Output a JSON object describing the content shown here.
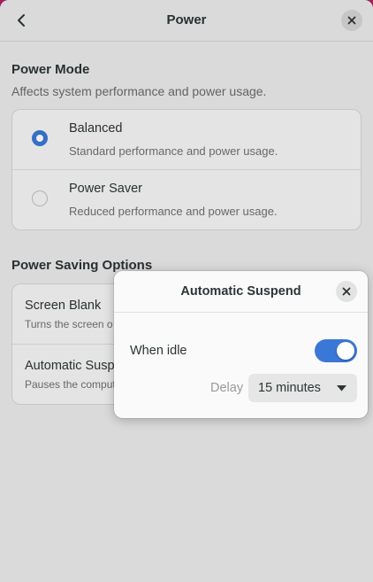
{
  "header": {
    "title": "Power"
  },
  "power_mode": {
    "title": "Power Mode",
    "subtitle": "Affects system performance and power usage.",
    "options": [
      {
        "label": "Balanced",
        "description": "Standard performance and power usage.",
        "selected": true
      },
      {
        "label": "Power Saver",
        "description": "Reduced performance and power usage.",
        "selected": false
      }
    ]
  },
  "power_saving": {
    "title": "Power Saving Options",
    "rows": [
      {
        "label": "Screen Blank",
        "description": "Turns the screen o"
      },
      {
        "label": "Automatic Susp",
        "description": "Pauses the comput"
      }
    ]
  },
  "dialog": {
    "title": "Automatic Suspend",
    "when_idle_label": "When idle",
    "when_idle_enabled": true,
    "delay_label": "Delay",
    "delay_value": "15 minutes"
  },
  "colors": {
    "accent": "#3a77d6",
    "wallpaper": "#a0205a",
    "window_bg": "#ebebeb"
  },
  "icons": {
    "back": "go-previous-icon",
    "close": "window-close-icon",
    "dropdown": "pan-down-icon"
  }
}
